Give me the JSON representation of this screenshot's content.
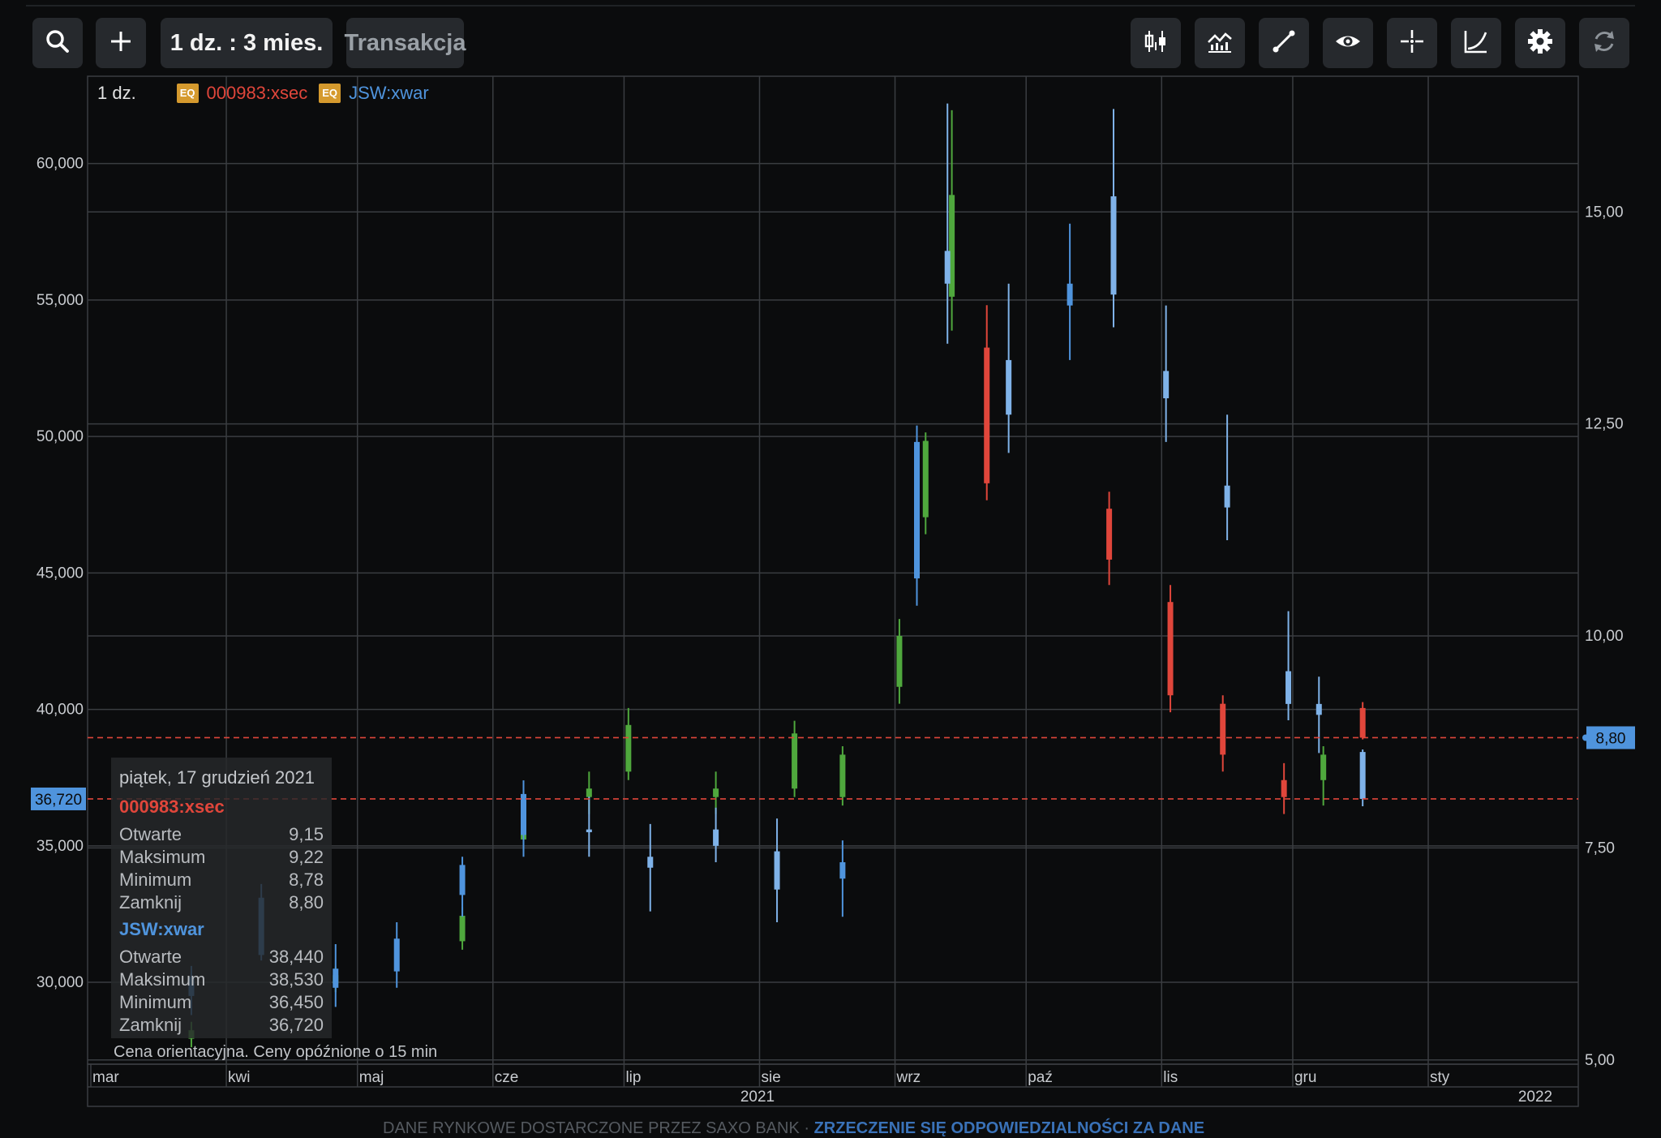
{
  "toolbar": {
    "search_icon": "search-icon",
    "add_icon": "plus-icon",
    "timeframe_label": "1 dz. : 3 mies.",
    "trade_label": "Transakcja",
    "right_icons": [
      "candlestick-icon",
      "indicators-icon",
      "draw-line-icon",
      "eye-icon",
      "crosshair-icon",
      "curve-icon",
      "gear-icon",
      "refresh-icon"
    ]
  },
  "legend": {
    "interval": "1 dz.",
    "badge": "EQ",
    "series1_name": "000983:xsec",
    "series2_name": "JSW:xwar"
  },
  "tooltip": {
    "date": "piątek, 17 grudzień 2021",
    "s1": {
      "name": "000983:xsec",
      "open_label": "Otwarte",
      "open": "9,15",
      "high_label": "Maksimum",
      "high": "9,22",
      "low_label": "Minimum",
      "low": "8,78",
      "close_label": "Zamknij",
      "close": "8,80"
    },
    "s2": {
      "name": "JSW:xwar",
      "open_label": "Otwarte",
      "open": "38,440",
      "high_label": "Maksimum",
      "high": "38,530",
      "low_label": "Minimum",
      "low": "36,450",
      "close_label": "Zamknij",
      "close": "36,720"
    }
  },
  "note": "Cena orientacyjna. Ceny opóźnione o 15 min",
  "footer": {
    "text": "DANE RYNKOWE DOSTARCZONE PRZEZ SAXO BANK",
    "link": "ZRZECZENIE SIĘ ODPOWIEDZIALNOŚCI ZA DANE"
  },
  "colors": {
    "up": "#4fa83d",
    "down": "#e0463b",
    "blue": "#4f94dd",
    "grid": "#3a3d41",
    "marker": "#e0463b",
    "label_bg": "#4f94dd"
  },
  "chart_data": {
    "type": "candlestick",
    "x_axis": {
      "months": [
        {
          "label": "mar",
          "date": "2021-03-01"
        },
        {
          "label": "kwi",
          "date": "2021-04-01"
        },
        {
          "label": "maj",
          "date": "2021-05-01"
        },
        {
          "label": "cze",
          "date": "2021-06-01"
        },
        {
          "label": "lip",
          "date": "2021-07-01"
        },
        {
          "label": "sie",
          "date": "2021-08-01"
        },
        {
          "label": "wrz",
          "date": "2021-09-01"
        },
        {
          "label": "paź",
          "date": "2021-10-01"
        },
        {
          "label": "lis",
          "date": "2021-11-01"
        },
        {
          "label": "gru",
          "date": "2021-12-01"
        },
        {
          "label": "sty",
          "date": "2022-01-01"
        }
      ],
      "years": [
        "2021",
        "2022"
      ]
    },
    "left_axis": {
      "ticks": [
        "30,000",
        "35,000",
        "40,000",
        "45,000",
        "50,000",
        "55,000",
        "60,000"
      ],
      "tick_values": [
        30000,
        35000,
        40000,
        45000,
        50000,
        55000,
        60000
      ],
      "range": [
        27000,
        63200
      ],
      "current_label": "36,720",
      "current_value": 36720
    },
    "right_axis": {
      "ticks": [
        "5,00",
        "7,50",
        "10,00",
        "12,50",
        "15,00"
      ],
      "tick_values": [
        5.0,
        7.5,
        10.0,
        12.5,
        15.0
      ],
      "range": [
        4.95,
        16.6
      ],
      "current_label": "8,80",
      "current_value": 8.8
    },
    "series": [
      {
        "name": "JSW:xwar",
        "axis": "left",
        "points": [
          {
            "date": "2021-03-24",
            "open": 29500,
            "high": 30600,
            "low": 28800,
            "close": 30200
          },
          {
            "date": "2021-04-09",
            "open": 31000,
            "high": 33600,
            "low": 30800,
            "close": 33100
          },
          {
            "date": "2021-04-26",
            "open": 29800,
            "high": 31400,
            "low": 29100,
            "close": 30500
          },
          {
            "date": "2021-05-10",
            "open": 30400,
            "high": 32200,
            "low": 29800,
            "close": 31600
          },
          {
            "date": "2021-05-25",
            "open": 33200,
            "high": 34600,
            "low": 32400,
            "close": 34300
          },
          {
            "date": "2021-06-08",
            "open": 35400,
            "high": 37400,
            "low": 34600,
            "close": 36900
          },
          {
            "date": "2021-06-23",
            "open": 35600,
            "high": 36800,
            "low": 34600,
            "close": 35500
          },
          {
            "date": "2021-07-07",
            "open": 34600,
            "high": 35800,
            "low": 32600,
            "close": 34200
          },
          {
            "date": "2021-07-22",
            "open": 35600,
            "high": 36400,
            "low": 34400,
            "close": 35000
          },
          {
            "date": "2021-08-05",
            "open": 34800,
            "high": 36000,
            "low": 32200,
            "close": 33400
          },
          {
            "date": "2021-08-20",
            "open": 33800,
            "high": 35200,
            "low": 32400,
            "close": 34400
          },
          {
            "date": "2021-09-06",
            "open": 44800,
            "high": 50400,
            "low": 43800,
            "close": 49800
          },
          {
            "date": "2021-09-13",
            "open": 56800,
            "high": 62200,
            "low": 53400,
            "close": 55600
          },
          {
            "date": "2021-09-27",
            "open": 52800,
            "high": 55600,
            "low": 49400,
            "close": 50800
          },
          {
            "date": "2021-10-11",
            "open": 54800,
            "high": 57800,
            "low": 52800,
            "close": 55600
          },
          {
            "date": "2021-10-21",
            "open": 58800,
            "high": 62000,
            "low": 54000,
            "close": 55200
          },
          {
            "date": "2021-11-02",
            "open": 52400,
            "high": 54800,
            "low": 49800,
            "close": 51400
          },
          {
            "date": "2021-11-16",
            "open": 48200,
            "high": 50800,
            "low": 46200,
            "close": 47400
          },
          {
            "date": "2021-11-30",
            "open": 41400,
            "high": 43600,
            "low": 39600,
            "close": 40200
          },
          {
            "date": "2021-12-07",
            "open": 40200,
            "high": 41200,
            "low": 38400,
            "close": 39800
          },
          {
            "date": "2021-12-17",
            "open": 38440,
            "high": 38530,
            "low": 36450,
            "close": 36720
          }
        ]
      },
      {
        "name": "000983:xsec",
        "axis": "right",
        "points": [
          {
            "date": "2021-03-24",
            "open": 5.25,
            "high": 5.45,
            "low": 5.15,
            "close": 5.35
          },
          {
            "date": "2021-04-26",
            "open": 5.9,
            "high": 6.1,
            "low": 5.8,
            "close": 6.0
          },
          {
            "date": "2021-05-25",
            "open": 6.4,
            "high": 6.8,
            "low": 6.3,
            "close": 6.7
          },
          {
            "date": "2021-06-08",
            "open": 7.6,
            "high": 8.0,
            "low": 7.4,
            "close": 7.8
          },
          {
            "date": "2021-06-23",
            "open": 8.1,
            "high": 8.4,
            "low": 7.9,
            "close": 8.2
          },
          {
            "date": "2021-07-02",
            "open": 8.4,
            "high": 9.15,
            "low": 8.3,
            "close": 8.95
          },
          {
            "date": "2021-07-22",
            "open": 8.1,
            "high": 8.4,
            "low": 7.9,
            "close": 8.2
          },
          {
            "date": "2021-08-09",
            "open": 8.2,
            "high": 9.0,
            "low": 8.1,
            "close": 8.85
          },
          {
            "date": "2021-08-20",
            "open": 8.1,
            "high": 8.7,
            "low": 8.0,
            "close": 8.6
          },
          {
            "date": "2021-09-02",
            "open": 9.4,
            "high": 10.2,
            "low": 9.2,
            "close": 10.0
          },
          {
            "date": "2021-09-08",
            "open": 11.4,
            "high": 12.4,
            "low": 11.2,
            "close": 12.3
          },
          {
            "date": "2021-09-14",
            "open": 14.0,
            "high": 16.2,
            "low": 13.6,
            "close": 15.2
          },
          {
            "date": "2021-09-22",
            "open": 13.4,
            "high": 13.9,
            "low": 11.6,
            "close": 11.8
          },
          {
            "date": "2021-10-20",
            "open": 11.5,
            "high": 11.7,
            "low": 10.6,
            "close": 10.9
          },
          {
            "date": "2021-11-03",
            "open": 10.4,
            "high": 10.6,
            "low": 9.1,
            "close": 9.3
          },
          {
            "date": "2021-11-15",
            "open": 9.2,
            "high": 9.3,
            "low": 8.4,
            "close": 8.6
          },
          {
            "date": "2021-11-29",
            "open": 8.3,
            "high": 8.5,
            "low": 7.9,
            "close": 8.1
          },
          {
            "date": "2021-12-08",
            "open": 8.3,
            "high": 8.7,
            "low": 8.0,
            "close": 8.6
          },
          {
            "date": "2021-12-17",
            "open": 9.15,
            "high": 9.22,
            "low": 8.78,
            "close": 8.8
          }
        ]
      }
    ],
    "reference_lines": [
      {
        "axis": "left",
        "value": 36720
      },
      {
        "axis": "right",
        "value": 8.8
      }
    ]
  }
}
